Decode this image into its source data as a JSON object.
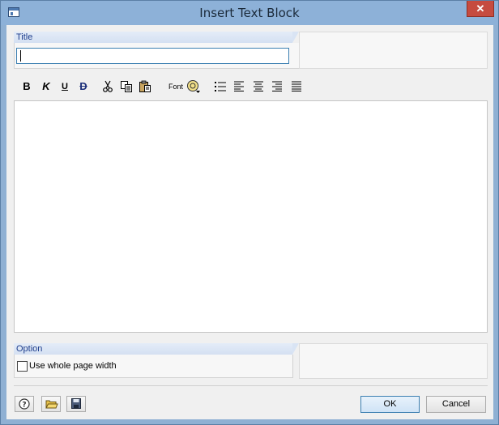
{
  "window": {
    "title": "Insert Text Block",
    "close_glyph": "✕"
  },
  "title_group": {
    "label": "Title",
    "value": ""
  },
  "toolbar": {
    "bold": "B",
    "italic": "K",
    "underline": "U",
    "strike": "D",
    "font": "Font"
  },
  "option_group": {
    "label": "Option",
    "checkbox_label": "Use whole page width",
    "checked": false
  },
  "footer": {
    "ok_label": "OK",
    "cancel_label": "Cancel"
  },
  "icons": [
    "app-icon",
    "cut-icon",
    "copy-icon",
    "paste-icon",
    "insert-symbol-icon",
    "bullet-list-icon",
    "align-left-icon",
    "align-center-icon",
    "align-right-icon",
    "justify-icon",
    "help-icon",
    "open-folder-icon",
    "save-icon"
  ]
}
